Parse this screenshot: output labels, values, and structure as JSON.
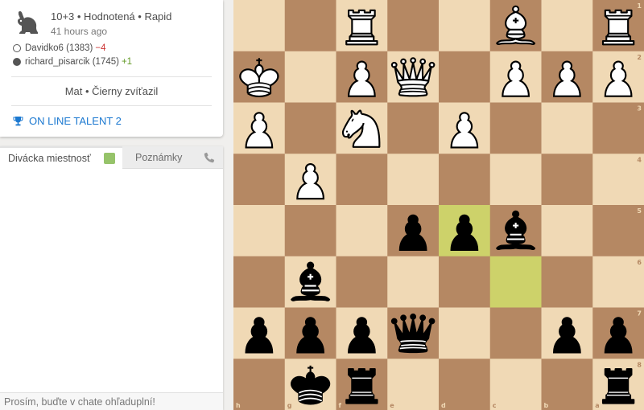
{
  "game": {
    "title": "10+3 • Hodnotená • Rapid",
    "time_ago": "41 hours ago",
    "players": [
      {
        "name": "Davidko6 (1383)",
        "rating_diff": "−4",
        "color": "white"
      },
      {
        "name": "richard_pisarcik (1745)",
        "rating_diff": "+1",
        "color": "black"
      }
    ],
    "result": "Mat • Čierny zvíťazil",
    "tournament": "ON LINE TALENT 2"
  },
  "chat": {
    "tab_room": "Divácka miestnosť",
    "tab_notes": "Poznámky",
    "input_placeholder": "Prosím, buďte v chate ohľaduplní!"
  },
  "board": {
    "orientation": "black",
    "files_bottom": [
      "h",
      "g",
      "f",
      "e",
      "d",
      "c",
      "b",
      "a"
    ],
    "ranks_right": [
      "1",
      "2",
      "3",
      "4",
      "5",
      "6",
      "7",
      "8"
    ],
    "colors": {
      "light": "#f0d9b5",
      "dark": "#b58863",
      "highlight_light": "#cdd26a",
      "highlight_dark": "#aaa23a"
    },
    "last_move_squares": [
      "d5",
      "c6"
    ],
    "pieces": [
      {
        "square": "f1",
        "piece": "rook",
        "color": "white"
      },
      {
        "square": "c1",
        "piece": "bishop",
        "color": "white"
      },
      {
        "square": "a1",
        "piece": "rook",
        "color": "white"
      },
      {
        "square": "h2",
        "piece": "king",
        "color": "white"
      },
      {
        "square": "f2",
        "piece": "pawn",
        "color": "white"
      },
      {
        "square": "e2",
        "piece": "queen",
        "color": "white"
      },
      {
        "square": "c2",
        "piece": "pawn",
        "color": "white"
      },
      {
        "square": "b2",
        "piece": "pawn",
        "color": "white"
      },
      {
        "square": "a2",
        "piece": "pawn",
        "color": "white"
      },
      {
        "square": "h3",
        "piece": "pawn",
        "color": "white"
      },
      {
        "square": "f3",
        "piece": "knight",
        "color": "white"
      },
      {
        "square": "d3",
        "piece": "pawn",
        "color": "white"
      },
      {
        "square": "g4",
        "piece": "pawn",
        "color": "white"
      },
      {
        "square": "e5",
        "piece": "pawn",
        "color": "black"
      },
      {
        "square": "d5",
        "piece": "pawn",
        "color": "black"
      },
      {
        "square": "c5",
        "piece": "bishop",
        "color": "black"
      },
      {
        "square": "g6",
        "piece": "bishop",
        "color": "black"
      },
      {
        "square": "h7",
        "piece": "pawn",
        "color": "black"
      },
      {
        "square": "g7",
        "piece": "pawn",
        "color": "black"
      },
      {
        "square": "f7",
        "piece": "pawn",
        "color": "black"
      },
      {
        "square": "e7",
        "piece": "queen",
        "color": "black"
      },
      {
        "square": "b7",
        "piece": "pawn",
        "color": "black"
      },
      {
        "square": "a7",
        "piece": "pawn",
        "color": "black"
      },
      {
        "square": "g8",
        "piece": "king",
        "color": "black"
      },
      {
        "square": "f8",
        "piece": "rook",
        "color": "black"
      },
      {
        "square": "a8",
        "piece": "rook",
        "color": "black"
      }
    ]
  }
}
